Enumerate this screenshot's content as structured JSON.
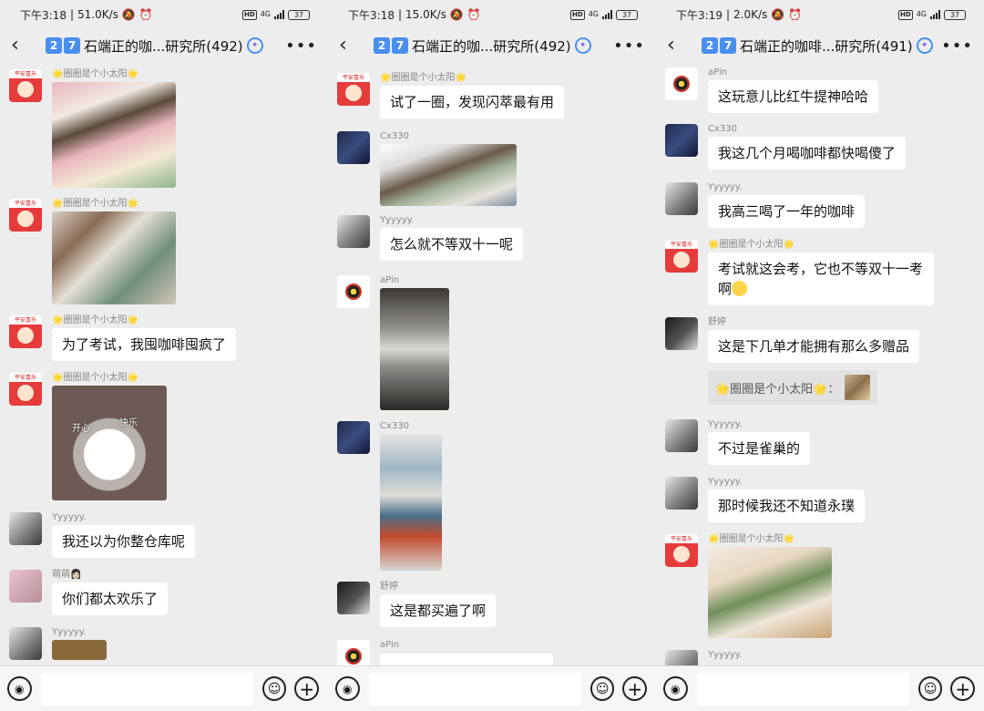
{
  "colors": {
    "accent": "#4a8ff0",
    "background": "#ededed",
    "bubble": "#ffffff"
  },
  "icons": {
    "back": "chevron-left-icon",
    "more": "more-icon",
    "voice": "voice-icon",
    "emoji": "emoji-icon",
    "plus": "plus-icon"
  },
  "screens": [
    {
      "status": {
        "time": "下午3:18",
        "speed": "51.0K/s",
        "network": "4G",
        "battery": "37"
      },
      "header": {
        "badge1": "2",
        "badge2": "7",
        "title": "石端正的咖...研究所(492)"
      },
      "messages": [
        {
          "sender": "🌟圈圈是个小太阳🌟"
        },
        {
          "sender": "🌟圈圈是个小太阳🌟"
        },
        {
          "sender": "🌟圈圈是个小太阳🌟",
          "text": "为了考试，我囤咖啡囤疯了"
        },
        {
          "sender": "🌟圈圈是个小太阳🌟",
          "sticker_left": "开心",
          "sticker_right": "快乐"
        },
        {
          "sender": "Yyyyyy.",
          "text": "我还以为你整仓库呢"
        },
        {
          "sender": "萌萌👩🏻",
          "text": "你们都太欢乐了"
        },
        {
          "sender": "Yyyyyy."
        }
      ]
    },
    {
      "status": {
        "time": "下午3:18",
        "speed": "15.0K/s",
        "network": "4G",
        "battery": "37"
      },
      "header": {
        "badge1": "2",
        "badge2": "7",
        "title": "石端正的咖...研究所(492)"
      },
      "messages": [
        {
          "sender": "🌟圈圈是个小太阳🌟",
          "text": "试了一圈，发现闪萃最有用"
        },
        {
          "sender": "Cx330"
        },
        {
          "sender": "Yyyyyy.",
          "text": "怎么就不等双十一呢"
        },
        {
          "sender": "aPin"
        },
        {
          "sender": "Cx330"
        },
        {
          "sender": "舒婷",
          "text": "这是都买遍了啊"
        },
        {
          "sender": "aPin"
        }
      ]
    },
    {
      "status": {
        "time": "下午3:19",
        "speed": "2.0K/s",
        "network": "4G",
        "battery": "37"
      },
      "header": {
        "badge1": "2",
        "badge2": "7",
        "title": "石端正的咖啡...研究所(491)"
      },
      "messages": [
        {
          "sender": "aPin",
          "text": "这玩意儿比红牛提神哈哈"
        },
        {
          "sender": "Cx330",
          "text": "我这几个月喝咖啡都快喝傻了"
        },
        {
          "sender": "Yyyyyy.",
          "text": "我高三喝了一年的咖啡"
        },
        {
          "sender": "🌟圈圈是个小太阳🌟",
          "text": "考试就这会考，它也不等双十一考啊"
        },
        {
          "sender": "舒婷",
          "text": "这是下几单才能拥有那么多赠品",
          "quote": "🌟圈圈是个小太阳🌟："
        },
        {
          "sender": "Yyyyyy.",
          "text": "不过是雀巢的"
        },
        {
          "sender": "Yyyyyy.",
          "text": "那时候我还不知道永璞"
        },
        {
          "sender": "🌟圈圈是个小太阳🌟"
        },
        {
          "sender": "Yyyyyy."
        }
      ]
    }
  ]
}
